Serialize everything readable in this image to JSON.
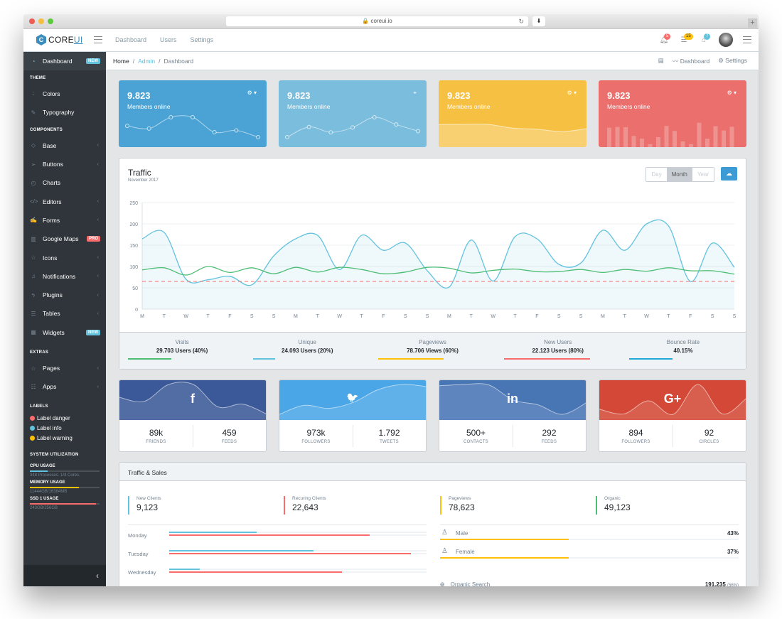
{
  "browser": {
    "url": "coreui.io",
    "traffic_lights": [
      "#ee5c54",
      "#f5be3f",
      "#5dc93f"
    ]
  },
  "header": {
    "logo_text": "CORE",
    "logo_accent": "UI",
    "logo_glyph": "C",
    "nav": [
      "Dashboard",
      "Users",
      "Settings"
    ],
    "badges": [
      {
        "icon": "bell-icon",
        "count": "5",
        "color": "#f86c6b"
      },
      {
        "icon": "list-icon",
        "count": "15",
        "color": "#ffc107"
      },
      {
        "icon": "map-pin-icon",
        "count": "7",
        "color": "#63c2de"
      }
    ]
  },
  "sidebar": {
    "dashboard": {
      "label": "Dashboard",
      "badge": "NEW"
    },
    "sections": {
      "theme": "THEME",
      "components": "COMPONENTS",
      "extras": "EXTRAS",
      "labels": "LABELS",
      "system": "SYSTEM UTILIZATION"
    },
    "theme_items": [
      {
        "label": "Colors",
        "icon": "drop-icon"
      },
      {
        "label": "Typography",
        "icon": "pencil-icon"
      }
    ],
    "component_items": [
      {
        "label": "Base",
        "icon": "puzzle-icon",
        "caret": true
      },
      {
        "label": "Buttons",
        "icon": "cursor-icon",
        "caret": true
      },
      {
        "label": "Charts",
        "icon": "pie-chart-icon",
        "caret": false
      },
      {
        "label": "Editors",
        "icon": "code-icon",
        "caret": true
      },
      {
        "label": "Forms",
        "icon": "note-icon",
        "caret": true
      },
      {
        "label": "Google Maps",
        "icon": "map-icon",
        "badge": "PRO"
      },
      {
        "label": "Icons",
        "icon": "star-icon",
        "caret": true
      },
      {
        "label": "Notifications",
        "icon": "bell-icon",
        "caret": true
      },
      {
        "label": "Plugins",
        "icon": "energy-icon",
        "caret": true
      },
      {
        "label": "Tables",
        "icon": "list-icon",
        "caret": true
      },
      {
        "label": "Widgets",
        "icon": "calculator-icon",
        "badge": "NEW"
      }
    ],
    "extra_items": [
      {
        "label": "Pages",
        "icon": "star-icon",
        "caret": true
      },
      {
        "label": "Apps",
        "icon": "layers-icon",
        "caret": true
      }
    ],
    "labels": [
      {
        "label": "Label danger",
        "color": "#f86c6b"
      },
      {
        "label": "Label info",
        "color": "#63c2de"
      },
      {
        "label": "Label warning",
        "color": "#ffc107"
      }
    ],
    "utilization": [
      {
        "title": "CPU USAGE",
        "sub": "348 Processes. 1/4 Cores.",
        "percent": 25,
        "color": "#63c2de"
      },
      {
        "title": "MEMORY USAGE",
        "sub": "11444GB/16384MB",
        "percent": 70,
        "color": "#ffc107"
      },
      {
        "title": "SSD 1 USAGE",
        "sub": "243GB/256GB",
        "percent": 95,
        "color": "#f86c6b"
      }
    ]
  },
  "breadcrumb": {
    "items": [
      "Home",
      "Admin",
      "Dashboard"
    ],
    "right": {
      "dashboard": "Dashboard",
      "settings": "Settings"
    }
  },
  "widgets": [
    {
      "value": "9.823",
      "label": "Members online",
      "color": "#4aa3d4",
      "tool": "gear-icon",
      "series": [
        65,
        59,
        84,
        84,
        51,
        55,
        40
      ]
    },
    {
      "value": "9.823",
      "label": "Members online",
      "color": "#7bbddc",
      "tool": "map-pin-icon",
      "series": [
        1,
        18,
        9,
        17,
        34,
        22,
        11
      ]
    },
    {
      "value": "9.823",
      "label": "Members online",
      "color": "#f6c142",
      "tool": "gear-icon",
      "series": [
        78,
        81,
        80,
        45,
        34,
        12,
        40
      ]
    },
    {
      "value": "9.823",
      "label": "Members online",
      "color": "#ea6f6d",
      "tool": "gear-icon",
      "series": [
        78,
        81,
        80,
        45,
        34,
        12,
        40,
        85,
        65,
        23,
        12,
        98,
        34,
        84,
        67,
        82
      ]
    }
  ],
  "traffic": {
    "title": "Traffic",
    "subtitle": "November 2017",
    "periods": [
      "Day",
      "Month",
      "Year"
    ],
    "active_period": "Month",
    "footer": [
      {
        "label": "Visits",
        "value": "29.703 Users (40%)",
        "percent": 40,
        "color": "#4dbd74"
      },
      {
        "label": "Unique",
        "value": "24.093 Users (20%)",
        "percent": 20,
        "color": "#63c2de"
      },
      {
        "label": "Pageviews",
        "value": "78.706 Views (60%)",
        "percent": 60,
        "color": "#ffc107"
      },
      {
        "label": "New Users",
        "value": "22.123 Users (80%)",
        "percent": 80,
        "color": "#f86c6b"
      },
      {
        "label": "Bounce Rate",
        "value": "40.15%",
        "percent": 40,
        "color": "#20a8d8"
      }
    ]
  },
  "chart_data": {
    "type": "line",
    "title": "Traffic",
    "subtitle": "November 2017",
    "ylim": [
      0,
      250
    ],
    "yticks": [
      0,
      50,
      100,
      150,
      200,
      250
    ],
    "categories": [
      "M",
      "T",
      "W",
      "T",
      "F",
      "S",
      "S",
      "M",
      "T",
      "W",
      "T",
      "F",
      "S",
      "S",
      "M",
      "T",
      "W",
      "T",
      "F",
      "S",
      "S",
      "M",
      "T",
      "W",
      "T",
      "F",
      "S",
      "S"
    ],
    "grid": true,
    "series": [
      {
        "name": "Series 1",
        "color": "#63c2de",
        "fill": true,
        "values": [
          165,
          180,
          70,
          69,
          77,
          57,
          125,
          165,
          173,
          93,
          173,
          138,
          155,
          90,
          52,
          162,
          66,
          170,
          165,
          105,
          108,
          185,
          138,
          200,
          195,
          65,
          155,
          98
        ]
      },
      {
        "name": "Series 2",
        "color": "#4dbd74",
        "fill": false,
        "values": [
          92,
          97,
          80,
          100,
          86,
          97,
          83,
          98,
          87,
          98,
          93,
          83,
          87,
          98,
          96,
          85,
          91,
          94,
          88,
          88,
          93,
          86,
          93,
          89,
          97,
          90,
          90,
          82
        ]
      },
      {
        "name": "Series 3",
        "color": "#f86c6b",
        "dashed": true,
        "values": [
          65,
          65,
          65,
          65,
          65,
          65,
          65,
          65,
          65,
          65,
          65,
          65,
          65,
          65,
          65,
          65,
          65,
          65,
          65,
          65,
          65,
          65,
          65,
          65,
          65,
          65,
          65,
          65
        ]
      }
    ]
  },
  "social": [
    {
      "network": "facebook",
      "icon": "f",
      "color": "#3b5998",
      "stats": [
        {
          "value": "89k",
          "label": "FRIENDS"
        },
        {
          "value": "459",
          "label": "FEEDS"
        }
      ],
      "series": [
        65,
        59,
        84,
        84,
        51,
        55,
        40
      ]
    },
    {
      "network": "twitter",
      "icon": "🐦",
      "color": "#4aa6e6",
      "stats": [
        {
          "value": "973k",
          "label": "FOLLOWERS"
        },
        {
          "value": "1.792",
          "label": "TWEETS"
        }
      ],
      "series": [
        1,
        13,
        9,
        17,
        34,
        41,
        38
      ]
    },
    {
      "network": "linkedin",
      "icon": "in",
      "color": "#4875b4",
      "stats": [
        {
          "value": "500+",
          "label": "CONTACTS"
        },
        {
          "value": "292",
          "label": "FEEDS"
        }
      ],
      "series": [
        78,
        81,
        80,
        45,
        34,
        12,
        40
      ]
    },
    {
      "network": "google-plus",
      "icon": "G+",
      "color": "#d34836",
      "stats": [
        {
          "value": "894",
          "label": "FOLLOWERS"
        },
        {
          "value": "92",
          "label": "CIRCLES"
        }
      ],
      "series": [
        35,
        23,
        56,
        22,
        97,
        23,
        64
      ]
    }
  ],
  "traffic_sales": {
    "title": "Traffic & Sales",
    "callouts": [
      {
        "label": "New Clients",
        "value": "9,123",
        "color": "#63c2de"
      },
      {
        "label": "Recuring Clients",
        "value": "22,643",
        "color": "#f86c6b"
      },
      {
        "label": "Pageviews",
        "value": "78,623",
        "color": "#ffc107"
      },
      {
        "label": "Organic",
        "value": "49,123",
        "color": "#4dbd74"
      }
    ],
    "days": [
      {
        "day": "Monday",
        "new": 34,
        "recurring": 78
      },
      {
        "day": "Tuesday",
        "new": 56,
        "recurring": 94
      },
      {
        "day": "Wednesday",
        "new": 12,
        "recurring": 67
      }
    ],
    "gender": [
      {
        "label": "Male",
        "value": "43%",
        "percent": 43
      },
      {
        "label": "Female",
        "value": "37%",
        "percent": 43
      }
    ],
    "organic": {
      "label": "Organic Search",
      "value": "191,235",
      "pct": "(56%)"
    }
  }
}
